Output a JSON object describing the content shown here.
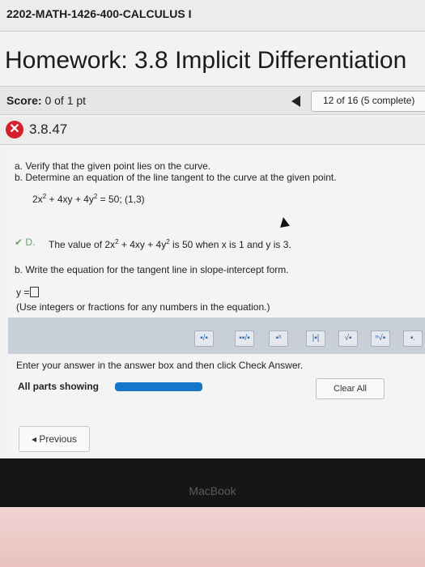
{
  "course": {
    "title": "2202-MATH-1426-400-CALCULUS I"
  },
  "homework": {
    "title": "Homework: 3.8 Implicit Differentiation"
  },
  "score": {
    "label": "Score:",
    "value": "0 of 1 pt"
  },
  "progress": {
    "text": "12 of 16 (5 complete)"
  },
  "question": {
    "number": "3.8.47"
  },
  "instructions": {
    "a": "a. Verify that the given point lies on the curve.",
    "b": "b. Determine an equation of the line tangent to the curve at the given point."
  },
  "equation": {
    "text_prefix": "2x",
    "text_mid": " + 4xy + 4y",
    "text_suffix": " = 50; (1,3)",
    "exponent": "2"
  },
  "part_a_result": {
    "prefix": "The value of 2x",
    "mid": " + 4xy + 4y",
    "suffix": " is 50 when x is 1 and y is 3.",
    "exp": "2",
    "marker": "D."
  },
  "part_b": {
    "prompt": "b. Write the equation for the tangent line in slope-intercept form.",
    "answer_label": "y =",
    "hint": "(Use integers or fractions for any numbers in the equation.)"
  },
  "toolbar": {
    "tools": [
      "fraction-icon",
      "mixed-number-icon",
      "exponent-icon",
      "absolute-value-icon",
      "sqrt-icon",
      "nth-root-icon",
      "decimal-icon"
    ],
    "glyphs": [
      "▪/▪",
      "▪▪/▪",
      "▪ˣ",
      "|▪|",
      "√▪",
      "ⁿ√▪",
      "▪."
    ]
  },
  "footer": {
    "enter_answer": "Enter your answer in the answer box and then click Check Answer.",
    "all_parts": "All parts showing",
    "clear_all": "Clear All",
    "previous": "◂ Previous"
  },
  "device": {
    "brand": "MacBook"
  },
  "colors": {
    "accent": "#1676c8",
    "error": "#d3202a"
  }
}
